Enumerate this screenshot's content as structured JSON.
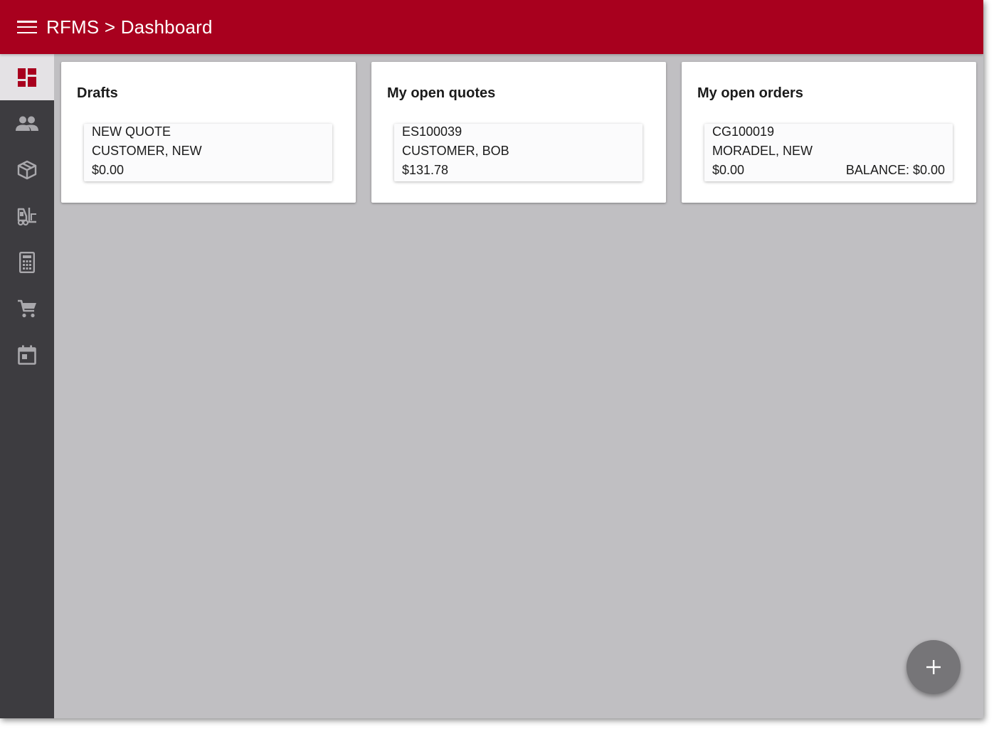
{
  "header": {
    "title": "RFMS > Dashboard",
    "menu_icon": "hamburger-menu-icon",
    "background": "#a8001e"
  },
  "sidebar": {
    "items": [
      {
        "name": "dashboard",
        "icon": "dashboard-icon",
        "active": true
      },
      {
        "name": "customers",
        "icon": "people-icon",
        "active": false
      },
      {
        "name": "products",
        "icon": "box-icon",
        "active": false
      },
      {
        "name": "inventory",
        "icon": "forklift-icon",
        "active": false
      },
      {
        "name": "quotes",
        "icon": "calculator-icon",
        "active": false
      },
      {
        "name": "orders",
        "icon": "cart-icon",
        "active": false
      },
      {
        "name": "calendar",
        "icon": "calendar-icon",
        "active": false
      }
    ],
    "accent": "#a8001e",
    "icon_color": "#a9a8ac"
  },
  "cards": {
    "drafts": {
      "title": "Drafts",
      "entries": [
        {
          "line1": "NEW QUOTE",
          "line2": "CUSTOMER, NEW",
          "line3": "$0.00"
        }
      ]
    },
    "quotes": {
      "title": "My open quotes",
      "entries": [
        {
          "line1": "ES100039",
          "line2": "CUSTOMER, BOB",
          "line3": "$131.78"
        }
      ]
    },
    "orders": {
      "title": "My open orders",
      "entries": [
        {
          "line1": "CG100019",
          "line2": "MORADEL, NEW",
          "line3": "$0.00",
          "balance": "BALANCE: $0.00"
        }
      ]
    }
  },
  "fab": {
    "icon": "plus-icon"
  }
}
